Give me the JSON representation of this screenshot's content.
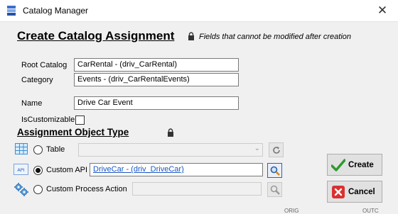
{
  "window": {
    "title": "Catalog Manager",
    "close_glyph": "✕"
  },
  "form": {
    "heading": "Create Catalog Assignment",
    "lock_note": "Fields that cannot be modified after creation",
    "root_catalog": {
      "label": "Root Catalog",
      "value": "CarRental - (driv_CarRental)"
    },
    "category": {
      "label": "Category",
      "value": "Events - (driv_CarRentalEvents)"
    },
    "name": {
      "label": "Name",
      "value": "Drive Car Event"
    },
    "is_customizable": {
      "label": "IsCustomizable",
      "checked": false
    }
  },
  "assignment": {
    "heading": "Assignment Object Type",
    "options": [
      {
        "label": "Table",
        "selected": false,
        "value": "",
        "icon": "table-icon"
      },
      {
        "label": "Custom API",
        "selected": true,
        "value": "DriveCar - (driv_DriveCar)",
        "icon": "api-icon"
      },
      {
        "label": "Custom Process Action",
        "selected": false,
        "value": "",
        "icon": "process-gears-icon"
      }
    ]
  },
  "buttons": {
    "create": "Create",
    "cancel": "Cancel"
  },
  "colors": {
    "accent": "#1a56c4",
    "background": "#f0f0f0",
    "create_check": "#2e9a2e",
    "cancel_x": "#d93030"
  },
  "background_fragments": [
    "ORIG",
    "OUTC"
  ]
}
